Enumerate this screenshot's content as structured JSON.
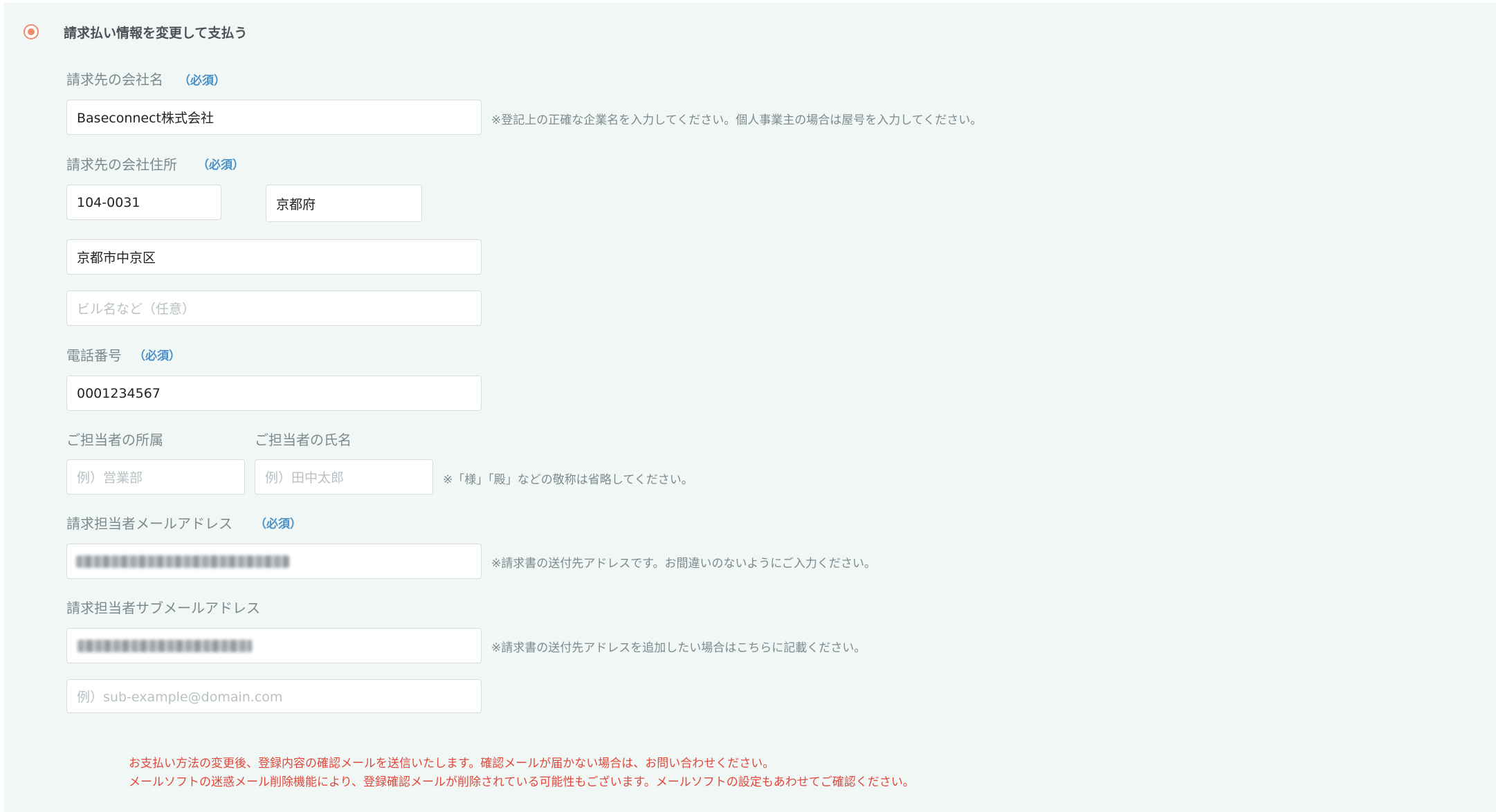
{
  "section": {
    "title": "請求払い情報を変更して支払う",
    "selected": true
  },
  "colors": {
    "panel_bg": "#f0f7f5",
    "radio_accent": "#ef8d6b",
    "required_blue": "#4c90c8",
    "warning_red": "#e0483c"
  },
  "required_label": "（必須）",
  "company": {
    "label": "請求先の会社名",
    "value": "Baseconnect株式会社",
    "note": "※登記上の正確な企業名を入力してください。個人事業主の場合は屋号を入力してください。"
  },
  "address": {
    "label": "請求先の会社住所",
    "postal_code": "104-0031",
    "prefecture": "京都府",
    "city": "京都市中京区",
    "building_placeholder": "ビル名など（任意）"
  },
  "phone": {
    "label": "電話番号",
    "value": "0001234567"
  },
  "contact": {
    "department_label": "ご担当者の所属",
    "department_placeholder": "例）営業部",
    "name_label": "ご担当者の氏名",
    "name_placeholder": "例）田中太郎",
    "note": "※「様」「殿」などの敬称は省略してください。"
  },
  "email": {
    "label": "請求担当者メールアドレス",
    "value_redacted": true,
    "note": "※請求書の送付先アドレスです。お間違いのないようにご入力ください。"
  },
  "sub_email": {
    "label": "請求担当者サブメールアドレス",
    "value_redacted": true,
    "note": "※請求書の送付先アドレスを追加したい場合はこちらに記載ください。",
    "extra_placeholder": "例）sub-example@domain.com"
  },
  "warnings": [
    "お支払い方法の変更後、登録内容の確認メールを送信いたします。確認メールが届かない場合は、お問い合わせください。",
    "メールソフトの迷惑メール削除機能により、登録確認メールが削除されている可能性もございます。メールソフトの設定もあわせてご確認ください。"
  ]
}
